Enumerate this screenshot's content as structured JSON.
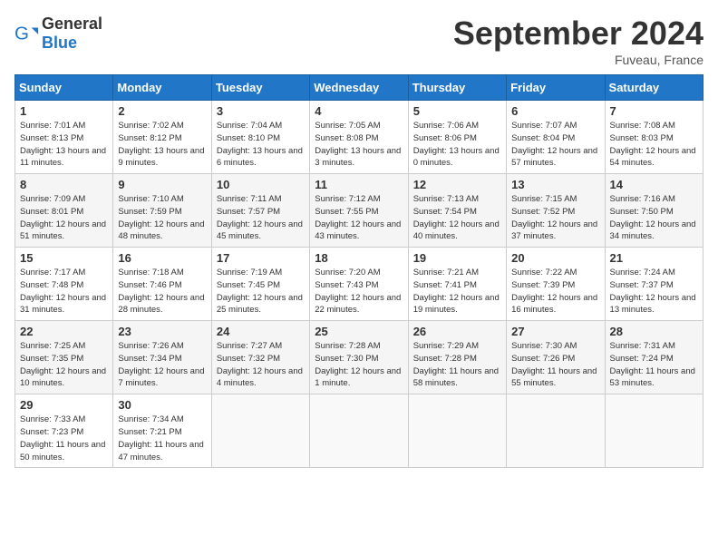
{
  "header": {
    "logo_general": "General",
    "logo_blue": "Blue",
    "month_title": "September 2024",
    "location": "Fuveau, France"
  },
  "weekdays": [
    "Sunday",
    "Monday",
    "Tuesday",
    "Wednesday",
    "Thursday",
    "Friday",
    "Saturday"
  ],
  "weeks": [
    [
      {
        "day": "1",
        "sunrise": "7:01 AM",
        "sunset": "8:13 PM",
        "daylight": "13 hours and 11 minutes."
      },
      {
        "day": "2",
        "sunrise": "7:02 AM",
        "sunset": "8:12 PM",
        "daylight": "13 hours and 9 minutes."
      },
      {
        "day": "3",
        "sunrise": "7:04 AM",
        "sunset": "8:10 PM",
        "daylight": "13 hours and 6 minutes."
      },
      {
        "day": "4",
        "sunrise": "7:05 AM",
        "sunset": "8:08 PM",
        "daylight": "13 hours and 3 minutes."
      },
      {
        "day": "5",
        "sunrise": "7:06 AM",
        "sunset": "8:06 PM",
        "daylight": "13 hours and 0 minutes."
      },
      {
        "day": "6",
        "sunrise": "7:07 AM",
        "sunset": "8:04 PM",
        "daylight": "12 hours and 57 minutes."
      },
      {
        "day": "7",
        "sunrise": "7:08 AM",
        "sunset": "8:03 PM",
        "daylight": "12 hours and 54 minutes."
      }
    ],
    [
      {
        "day": "8",
        "sunrise": "7:09 AM",
        "sunset": "8:01 PM",
        "daylight": "12 hours and 51 minutes."
      },
      {
        "day": "9",
        "sunrise": "7:10 AM",
        "sunset": "7:59 PM",
        "daylight": "12 hours and 48 minutes."
      },
      {
        "day": "10",
        "sunrise": "7:11 AM",
        "sunset": "7:57 PM",
        "daylight": "12 hours and 45 minutes."
      },
      {
        "day": "11",
        "sunrise": "7:12 AM",
        "sunset": "7:55 PM",
        "daylight": "12 hours and 43 minutes."
      },
      {
        "day": "12",
        "sunrise": "7:13 AM",
        "sunset": "7:54 PM",
        "daylight": "12 hours and 40 minutes."
      },
      {
        "day": "13",
        "sunrise": "7:15 AM",
        "sunset": "7:52 PM",
        "daylight": "12 hours and 37 minutes."
      },
      {
        "day": "14",
        "sunrise": "7:16 AM",
        "sunset": "7:50 PM",
        "daylight": "12 hours and 34 minutes."
      }
    ],
    [
      {
        "day": "15",
        "sunrise": "7:17 AM",
        "sunset": "7:48 PM",
        "daylight": "12 hours and 31 minutes."
      },
      {
        "day": "16",
        "sunrise": "7:18 AM",
        "sunset": "7:46 PM",
        "daylight": "12 hours and 28 minutes."
      },
      {
        "day": "17",
        "sunrise": "7:19 AM",
        "sunset": "7:45 PM",
        "daylight": "12 hours and 25 minutes."
      },
      {
        "day": "18",
        "sunrise": "7:20 AM",
        "sunset": "7:43 PM",
        "daylight": "12 hours and 22 minutes."
      },
      {
        "day": "19",
        "sunrise": "7:21 AM",
        "sunset": "7:41 PM",
        "daylight": "12 hours and 19 minutes."
      },
      {
        "day": "20",
        "sunrise": "7:22 AM",
        "sunset": "7:39 PM",
        "daylight": "12 hours and 16 minutes."
      },
      {
        "day": "21",
        "sunrise": "7:24 AM",
        "sunset": "7:37 PM",
        "daylight": "12 hours and 13 minutes."
      }
    ],
    [
      {
        "day": "22",
        "sunrise": "7:25 AM",
        "sunset": "7:35 PM",
        "daylight": "12 hours and 10 minutes."
      },
      {
        "day": "23",
        "sunrise": "7:26 AM",
        "sunset": "7:34 PM",
        "daylight": "12 hours and 7 minutes."
      },
      {
        "day": "24",
        "sunrise": "7:27 AM",
        "sunset": "7:32 PM",
        "daylight": "12 hours and 4 minutes."
      },
      {
        "day": "25",
        "sunrise": "7:28 AM",
        "sunset": "7:30 PM",
        "daylight": "12 hours and 1 minute."
      },
      {
        "day": "26",
        "sunrise": "7:29 AM",
        "sunset": "7:28 PM",
        "daylight": "11 hours and 58 minutes."
      },
      {
        "day": "27",
        "sunrise": "7:30 AM",
        "sunset": "7:26 PM",
        "daylight": "11 hours and 55 minutes."
      },
      {
        "day": "28",
        "sunrise": "7:31 AM",
        "sunset": "7:24 PM",
        "daylight": "11 hours and 53 minutes."
      }
    ],
    [
      {
        "day": "29",
        "sunrise": "7:33 AM",
        "sunset": "7:23 PM",
        "daylight": "11 hours and 50 minutes."
      },
      {
        "day": "30",
        "sunrise": "7:34 AM",
        "sunset": "7:21 PM",
        "daylight": "11 hours and 47 minutes."
      },
      null,
      null,
      null,
      null,
      null
    ]
  ]
}
